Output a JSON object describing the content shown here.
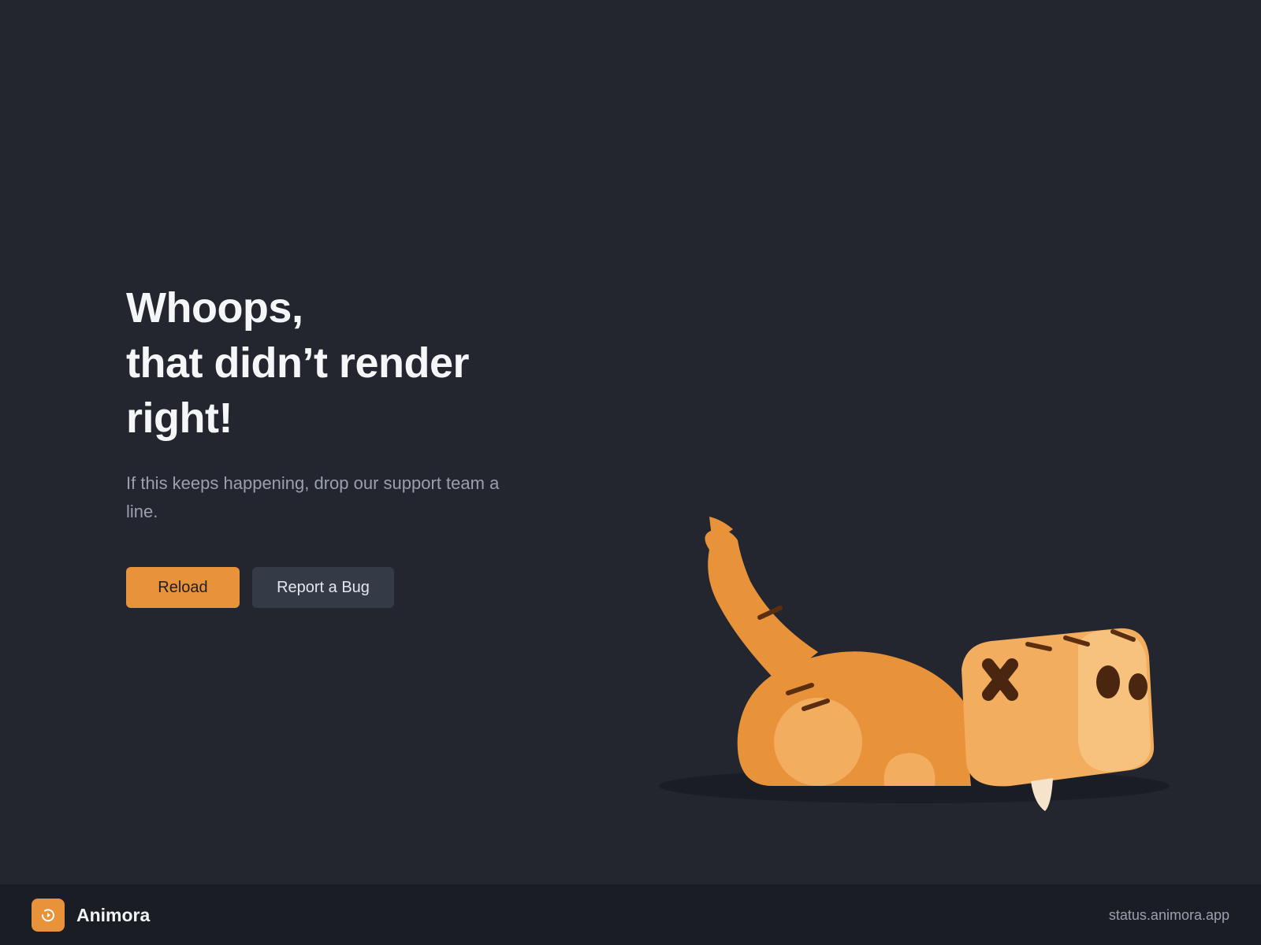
{
  "error": {
    "title_lines": [
      "Whoops,",
      "that didn’t render",
      "right!"
    ],
    "subtitle": "If this keeps happening, drop our support team a line."
  },
  "actions": {
    "reload_label": "Reload",
    "report_label": "Report a Bug"
  },
  "footer": {
    "brand_name": "Animora",
    "status_link": "status.animora.app",
    "logo_icon": "refresh-icon"
  },
  "illustration": {
    "icon": "knocked-out-cat-illustration"
  },
  "colors": {
    "background": "#23252f",
    "footer_background": "#1b1d25",
    "accent": "#e8923a",
    "secondary_button": "#353a47",
    "heading_text": "#f5f6f8",
    "muted_text": "#9aa0ad"
  }
}
